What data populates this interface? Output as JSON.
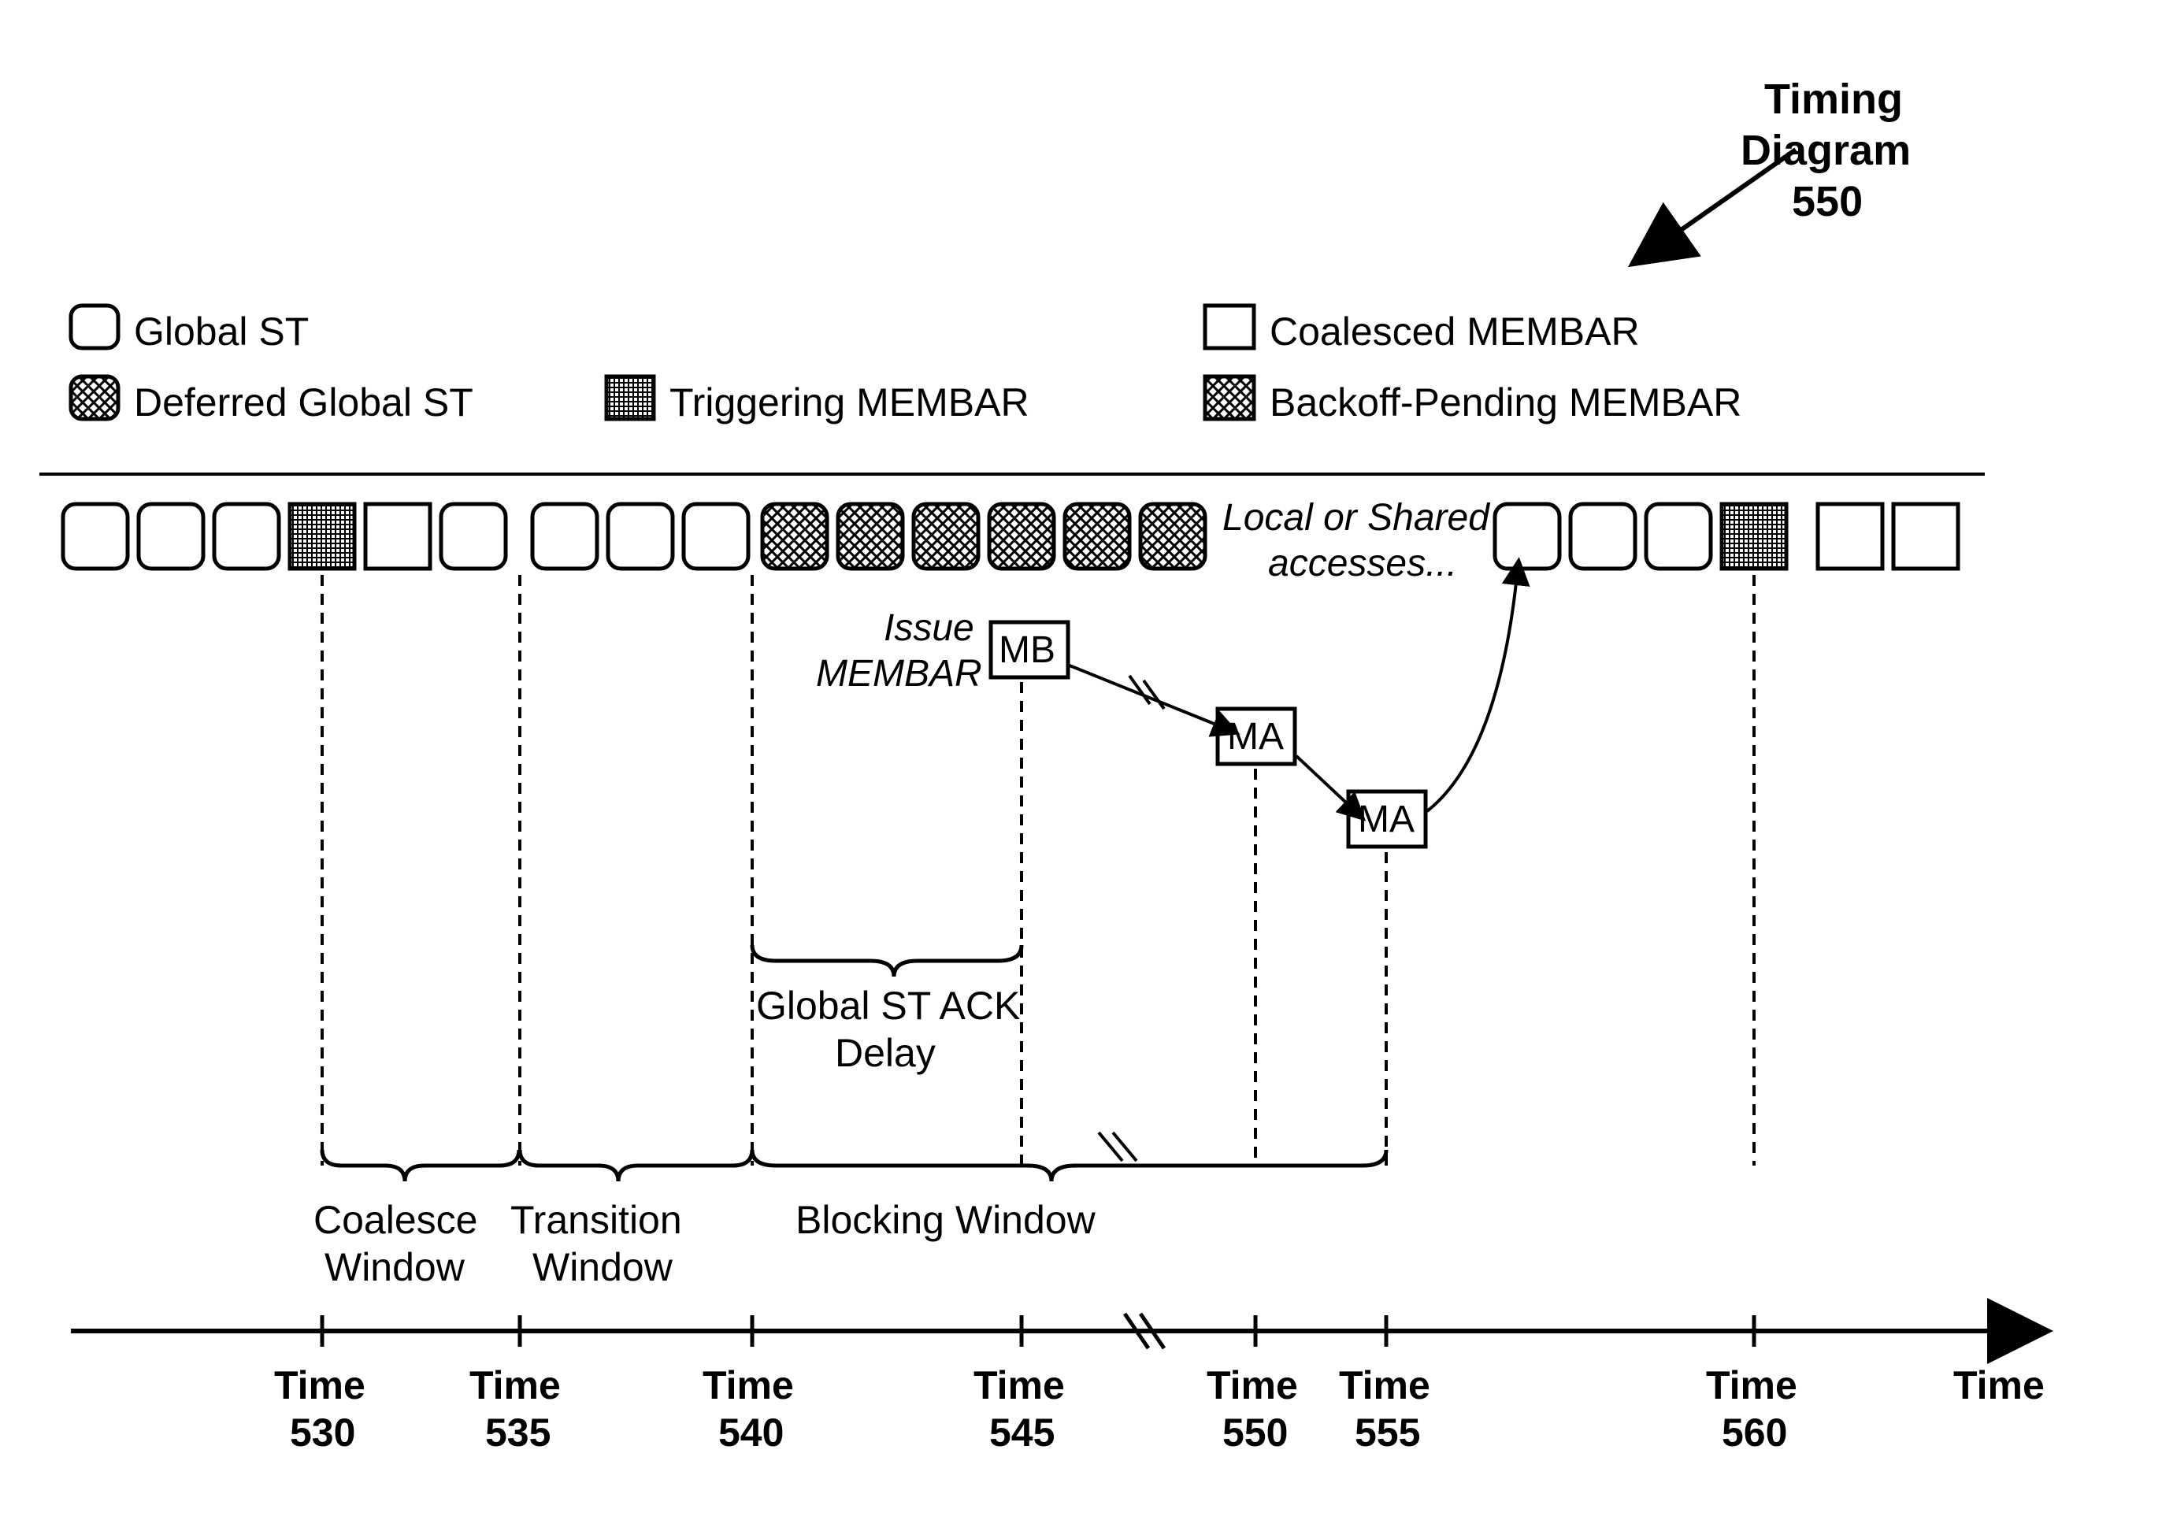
{
  "title": {
    "line1": "Timing",
    "line2": "Diagram",
    "line3": "550"
  },
  "legend": {
    "globalST": "Global ST",
    "deferredGlobalST": "Deferred Global ST",
    "triggeringMEMBAR": "Triggering MEMBAR",
    "coalescedMEMBAR": "Coalesced MEMBAR",
    "backoffPendingMEMBAR": "Backoff-Pending MEMBAR"
  },
  "rowLabels": {
    "localOrShared1": "Local or Shared",
    "localOrShared2": "accesses...",
    "issueMEMBAR1": "Issue",
    "issueMEMBAR2": "MEMBAR",
    "mb": "MB",
    "ma": "MA"
  },
  "braces": {
    "coalesce1": "Coalesce",
    "coalesce2": "Window",
    "transition1": "Transition",
    "transition2": "Window",
    "blocking": "Blocking Window",
    "ackDelay1": "Global ST ACK",
    "ackDelay2": "Delay"
  },
  "axis": {
    "time530a": "Time",
    "time530b": "530",
    "time535a": "Time",
    "time535b": "535",
    "time540a": "Time",
    "time540b": "540",
    "time545a": "Time",
    "time545b": "545",
    "time550a": "Time",
    "time550b": "550",
    "time555a": "Time",
    "time555b": "555",
    "time560a": "Time",
    "time560b": "560",
    "timeLabel": "Time"
  },
  "chart_data": {
    "type": "timing-diagram",
    "time_points": [
      530,
      535,
      540,
      545,
      550,
      555,
      560
    ],
    "windows": [
      {
        "name": "Coalesce Window",
        "start": 530,
        "end": 535
      },
      {
        "name": "Transition Window",
        "start": 535,
        "end": 540
      },
      {
        "name": "Global ST ACK Delay",
        "start": 540,
        "end": 545
      },
      {
        "name": "Blocking Window",
        "start": 540,
        "end": 555
      }
    ],
    "event_sequence": [
      {
        "type": "Global ST",
        "count": 3
      },
      {
        "type": "Triggering MEMBAR",
        "count": 1,
        "at": 530
      },
      {
        "type": "Coalesced MEMBAR",
        "count": 1
      },
      {
        "type": "Global ST",
        "count": 1
      },
      {
        "type": "Global ST",
        "count": 3,
        "between": [
          535,
          540
        ]
      },
      {
        "type": "Deferred Global ST",
        "count": 6,
        "between": [
          540,
          545
        ]
      },
      {
        "type": "Local or Shared accesses",
        "between": [
          545,
          555
        ]
      },
      {
        "type": "Issue MEMBAR MB",
        "at": 545
      },
      {
        "type": "MA",
        "at": 550
      },
      {
        "type": "MA",
        "at": 555
      },
      {
        "type": "Global ST",
        "count": 3,
        "after": 555
      },
      {
        "type": "Triggering MEMBAR",
        "count": 1,
        "at": 560
      },
      {
        "type": "Coalesced MEMBAR",
        "count": 2,
        "after": 560
      }
    ]
  }
}
